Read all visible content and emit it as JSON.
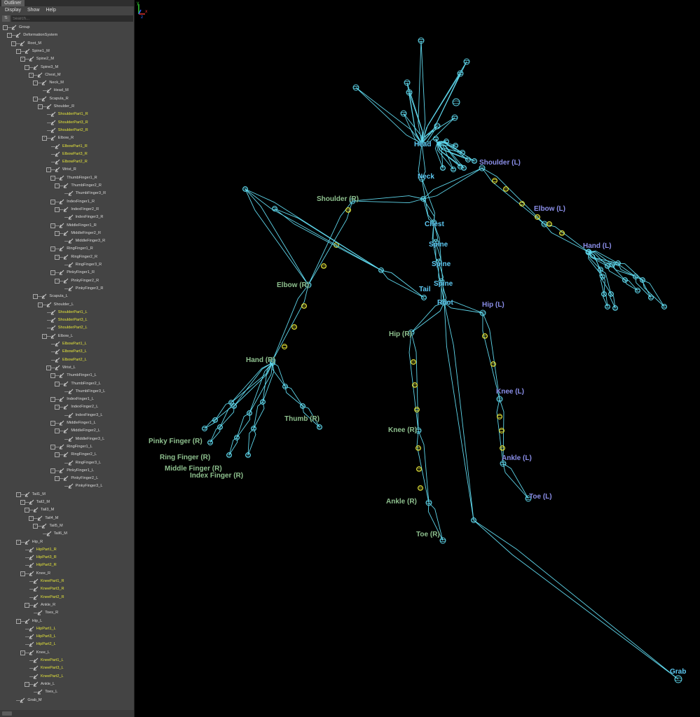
{
  "outliner": {
    "tab_title": "Outliner",
    "menus": [
      "Display",
      "Show",
      "Help"
    ],
    "search_placeholder": "Search...",
    "tree": [
      {
        "label": "Group",
        "depth": 0,
        "exp": "-",
        "hl": false
      },
      {
        "label": "DeformationSystem",
        "depth": 1,
        "exp": "-",
        "hl": false
      },
      {
        "label": "Root_M",
        "depth": 2,
        "exp": "-",
        "hl": false
      },
      {
        "label": "Spine1_M",
        "depth": 3,
        "exp": "-",
        "hl": false
      },
      {
        "label": "Spine2_M",
        "depth": 4,
        "exp": "-",
        "hl": false
      },
      {
        "label": "Spine3_M",
        "depth": 5,
        "exp": "-",
        "hl": false
      },
      {
        "label": "Chest_M",
        "depth": 6,
        "exp": "-",
        "hl": false
      },
      {
        "label": "Neck_M",
        "depth": 7,
        "exp": "-",
        "hl": false
      },
      {
        "label": "Head_M",
        "depth": 8,
        "exp": "",
        "hl": false
      },
      {
        "label": "Scapula_R",
        "depth": 7,
        "exp": "-",
        "hl": false
      },
      {
        "label": "Shoulder_R",
        "depth": 8,
        "exp": "-",
        "hl": false
      },
      {
        "label": "ShoulderPart1_R",
        "depth": 9,
        "exp": "",
        "hl": true
      },
      {
        "label": "ShoulderPart3_R",
        "depth": 9,
        "exp": "",
        "hl": true
      },
      {
        "label": "ShoulderPart2_R",
        "depth": 9,
        "exp": "",
        "hl": true
      },
      {
        "label": "Elbow_R",
        "depth": 9,
        "exp": "-",
        "hl": false
      },
      {
        "label": "ElbowPart1_R",
        "depth": 10,
        "exp": "",
        "hl": true
      },
      {
        "label": "ElbowPart3_R",
        "depth": 10,
        "exp": "",
        "hl": true
      },
      {
        "label": "ElbowPart2_R",
        "depth": 10,
        "exp": "",
        "hl": true
      },
      {
        "label": "Wrist_R",
        "depth": 10,
        "exp": "-",
        "hl": false
      },
      {
        "label": "ThumbFinger1_R",
        "depth": 11,
        "exp": "-",
        "hl": false
      },
      {
        "label": "ThumbFinger2_R",
        "depth": 12,
        "exp": "-",
        "hl": false
      },
      {
        "label": "ThumbFinger3_R",
        "depth": 13,
        "exp": "",
        "hl": false
      },
      {
        "label": "IndexFinger1_R",
        "depth": 11,
        "exp": "-",
        "hl": false
      },
      {
        "label": "IndexFinger2_R",
        "depth": 12,
        "exp": "-",
        "hl": false
      },
      {
        "label": "IndexFinger3_R",
        "depth": 13,
        "exp": "",
        "hl": false
      },
      {
        "label": "MiddleFinger1_R",
        "depth": 11,
        "exp": "-",
        "hl": false
      },
      {
        "label": "MiddleFinger2_R",
        "depth": 12,
        "exp": "-",
        "hl": false
      },
      {
        "label": "MiddleFinger3_R",
        "depth": 13,
        "exp": "",
        "hl": false
      },
      {
        "label": "RingFinger1_R",
        "depth": 11,
        "exp": "-",
        "hl": false
      },
      {
        "label": "RingFinger2_R",
        "depth": 12,
        "exp": "-",
        "hl": false
      },
      {
        "label": "RingFinger3_R",
        "depth": 13,
        "exp": "",
        "hl": false
      },
      {
        "label": "PinkyFinger1_R",
        "depth": 11,
        "exp": "-",
        "hl": false
      },
      {
        "label": "PinkyFinger2_R",
        "depth": 12,
        "exp": "-",
        "hl": false
      },
      {
        "label": "PinkyFinger3_R",
        "depth": 13,
        "exp": "",
        "hl": false
      },
      {
        "label": "Scapula_L",
        "depth": 7,
        "exp": "-",
        "hl": false
      },
      {
        "label": "Shoulder_L",
        "depth": 8,
        "exp": "-",
        "hl": false
      },
      {
        "label": "ShoulderPart1_L",
        "depth": 9,
        "exp": "",
        "hl": true
      },
      {
        "label": "ShoulderPart3_L",
        "depth": 9,
        "exp": "",
        "hl": true
      },
      {
        "label": "ShoulderPart2_L",
        "depth": 9,
        "exp": "",
        "hl": true
      },
      {
        "label": "Elbow_L",
        "depth": 9,
        "exp": "-",
        "hl": false
      },
      {
        "label": "ElbowPart1_L",
        "depth": 10,
        "exp": "",
        "hl": true
      },
      {
        "label": "ElbowPart3_L",
        "depth": 10,
        "exp": "",
        "hl": true
      },
      {
        "label": "ElbowPart2_L",
        "depth": 10,
        "exp": "",
        "hl": true
      },
      {
        "label": "Wrist_L",
        "depth": 10,
        "exp": "-",
        "hl": false
      },
      {
        "label": "ThumbFinger1_L",
        "depth": 11,
        "exp": "-",
        "hl": false
      },
      {
        "label": "ThumbFinger2_L",
        "depth": 12,
        "exp": "-",
        "hl": false
      },
      {
        "label": "ThumbFinger3_L",
        "depth": 13,
        "exp": "",
        "hl": false
      },
      {
        "label": "IndexFinger1_L",
        "depth": 11,
        "exp": "-",
        "hl": false
      },
      {
        "label": "IndexFinger2_L",
        "depth": 12,
        "exp": "-",
        "hl": false
      },
      {
        "label": "IndexFinger3_L",
        "depth": 13,
        "exp": "",
        "hl": false
      },
      {
        "label": "MiddleFinger1_L",
        "depth": 11,
        "exp": "-",
        "hl": false
      },
      {
        "label": "MiddleFinger2_L",
        "depth": 12,
        "exp": "-",
        "hl": false
      },
      {
        "label": "MiddleFinger3_L",
        "depth": 13,
        "exp": "",
        "hl": false
      },
      {
        "label": "RingFinger1_L",
        "depth": 11,
        "exp": "-",
        "hl": false
      },
      {
        "label": "RingFinger2_L",
        "depth": 12,
        "exp": "-",
        "hl": false
      },
      {
        "label": "RingFinger3_L",
        "depth": 13,
        "exp": "",
        "hl": false
      },
      {
        "label": "PinkyFinger1_L",
        "depth": 11,
        "exp": "-",
        "hl": false
      },
      {
        "label": "PinkyFinger2_L",
        "depth": 12,
        "exp": "-",
        "hl": false
      },
      {
        "label": "PinkyFinger3_L",
        "depth": 13,
        "exp": "",
        "hl": false
      },
      {
        "label": "Tail1_M",
        "depth": 3,
        "exp": "-",
        "hl": false
      },
      {
        "label": "Tail2_M",
        "depth": 4,
        "exp": "-",
        "hl": false
      },
      {
        "label": "Tail3_M",
        "depth": 5,
        "exp": "-",
        "hl": false
      },
      {
        "label": "Tail4_M",
        "depth": 6,
        "exp": "-",
        "hl": false
      },
      {
        "label": "Tail5_M",
        "depth": 7,
        "exp": "-",
        "hl": false
      },
      {
        "label": "Tail6_M",
        "depth": 8,
        "exp": "",
        "hl": false
      },
      {
        "label": "Hip_R",
        "depth": 3,
        "exp": "-",
        "hl": false
      },
      {
        "label": "HipPart1_R",
        "depth": 4,
        "exp": "",
        "hl": true
      },
      {
        "label": "HipPart3_R",
        "depth": 4,
        "exp": "",
        "hl": true
      },
      {
        "label": "HipPart2_R",
        "depth": 4,
        "exp": "",
        "hl": true
      },
      {
        "label": "Knee_R",
        "depth": 4,
        "exp": "-",
        "hl": false
      },
      {
        "label": "KneePart1_R",
        "depth": 5,
        "exp": "",
        "hl": true
      },
      {
        "label": "KneePart3_R",
        "depth": 5,
        "exp": "",
        "hl": true
      },
      {
        "label": "KneePart2_R",
        "depth": 5,
        "exp": "",
        "hl": true
      },
      {
        "label": "Ankle_R",
        "depth": 5,
        "exp": "-",
        "hl": false
      },
      {
        "label": "Toes_R",
        "depth": 6,
        "exp": "",
        "hl": false
      },
      {
        "label": "Hip_L",
        "depth": 3,
        "exp": "-",
        "hl": false
      },
      {
        "label": "HipPart1_L",
        "depth": 4,
        "exp": "",
        "hl": true
      },
      {
        "label": "HipPart3_L",
        "depth": 4,
        "exp": "",
        "hl": true
      },
      {
        "label": "HipPart2_L",
        "depth": 4,
        "exp": "",
        "hl": true
      },
      {
        "label": "Knee_L",
        "depth": 4,
        "exp": "-",
        "hl": false
      },
      {
        "label": "KneePart1_L",
        "depth": 5,
        "exp": "",
        "hl": true
      },
      {
        "label": "KneePart3_L",
        "depth": 5,
        "exp": "",
        "hl": true
      },
      {
        "label": "KneePart2_L",
        "depth": 5,
        "exp": "",
        "hl": true
      },
      {
        "label": "Ankle_L",
        "depth": 5,
        "exp": "-",
        "hl": false
      },
      {
        "label": "Toes_L",
        "depth": 6,
        "exp": "",
        "hl": false
      },
      {
        "label": "Grab_M",
        "depth": 2,
        "exp": "",
        "hl": false
      }
    ]
  },
  "viewport": {
    "labels": {
      "head": "Head",
      "neck": "Neck",
      "shoulder_l": "Shoulder (L)",
      "shoulder_r": "Shoulder (R)",
      "elbow_l": "Elbow (L)",
      "elbow_r": "Elbow (R)",
      "chest": "Chest",
      "hand_l": "Hand (L)",
      "hand_r": "Hand (R)",
      "spine1": "Spine",
      "spine2": "Spine",
      "spine3": "Spine",
      "tail": "Tail",
      "root": "Root",
      "hip_l": "Hip (L)",
      "hip_r": "Hip (R)",
      "knee_l": "Knee (L)",
      "knee_r": "Knee (R)",
      "ankle_l": "Ankle (L)",
      "ankle_r": "Ankle (R)",
      "toe_l": "Toe (L)",
      "toe_r": "Toe (R)",
      "thumb_r": "Thumb (R)",
      "pinky_r": "Pinky Finger (R)",
      "ring_r": "Ring Finger (R)",
      "middle_r": "Middle Finger (R)",
      "index_r": "Index Finger (R)",
      "grab": "Grab"
    },
    "axis": {
      "y": "y",
      "x": "x",
      "z": "z"
    }
  },
  "colors": {
    "bone": "#5fd7ec",
    "joint_yellow": "#e8e83a",
    "label_green": "#8ec08e",
    "label_blue": "#8a8ee8",
    "label_cyan": "#5ecaf4",
    "highlight_text": "#e3e33a"
  }
}
